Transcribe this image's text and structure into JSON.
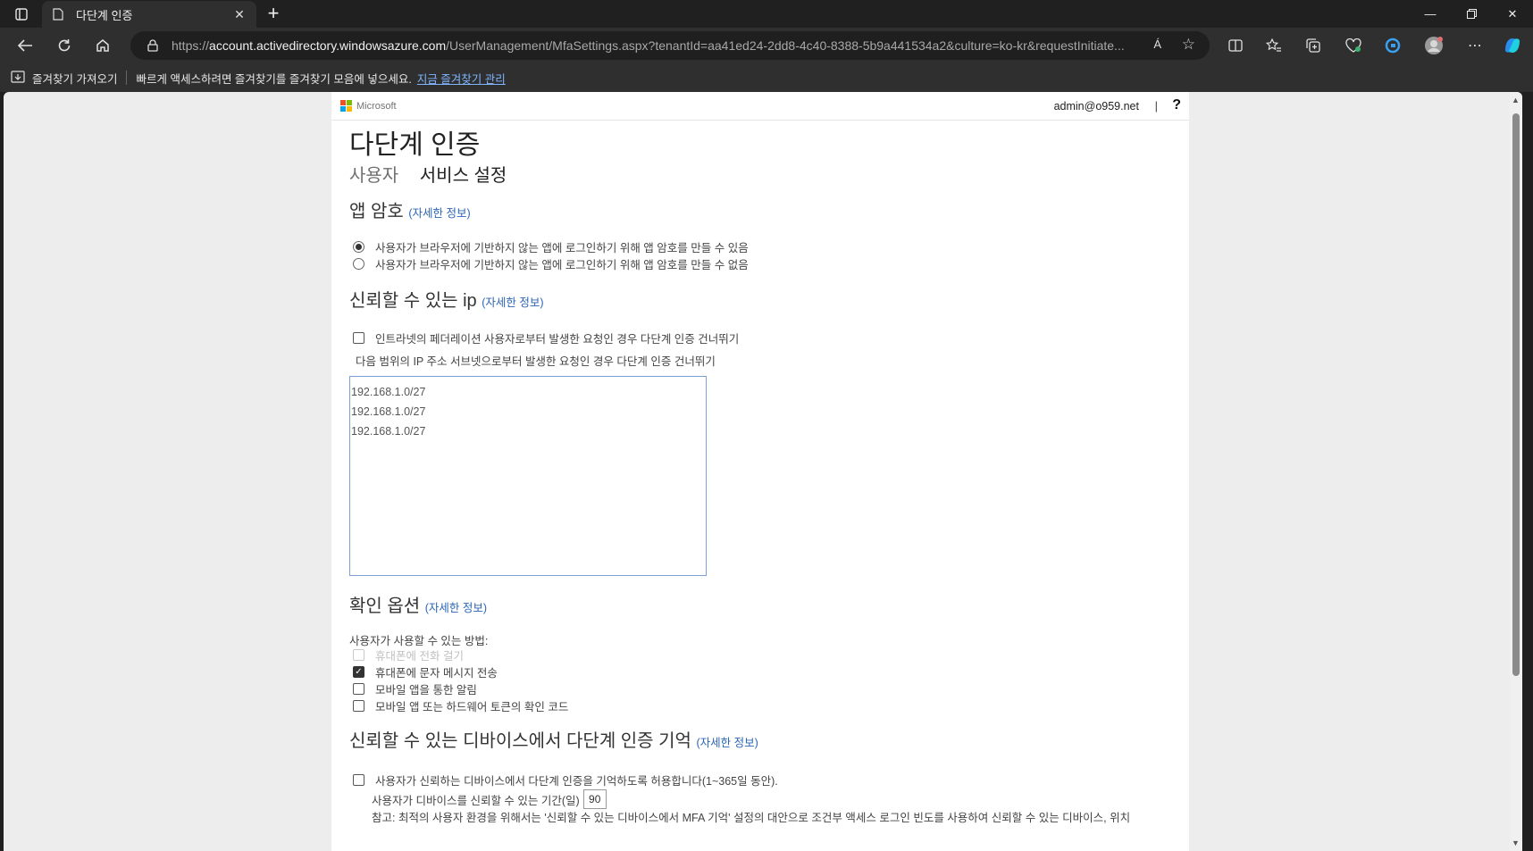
{
  "browser": {
    "tab_title": "다단계 인증",
    "url_prefix": "https://",
    "url_host": "account.activedirectory.windowsazure.com",
    "url_path": "/UserManagement/MfaSettings.aspx?tenantId=aa41ed24-2dd8-4c40-8388-5b9a441534a2&culture=ko-kr&requestInitiate...",
    "new_tab_glyph": "+",
    "read_aloud": "Á"
  },
  "favorites_bar": {
    "import_label": "즐겨찾기 가져오기",
    "hint": "빠르게 액세스하려면 즐겨찾기를 즐겨찾기 모음에 넣으세요.",
    "manage_link": "지금 즐겨찾기 관리"
  },
  "page_header": {
    "brand": "Microsoft",
    "user": "admin@o959.net",
    "separator": "|",
    "help": "?"
  },
  "page": {
    "title": "다단계 인증",
    "tabs": [
      {
        "label": "사용자"
      },
      {
        "label": "서비스 설정"
      }
    ],
    "more_info": "(자세한 정보)"
  },
  "app_passwords": {
    "title": "앱 암호",
    "options": [
      {
        "label": "사용자가 브라우저에 기반하지 않는 앱에 로그인하기 위해 앱 암호를 만들 수 있음",
        "selected": true
      },
      {
        "label": "사용자가 브라우저에 기반하지 않는 앱에 로그인하기 위해 앱 암호를 만들 수 없음",
        "selected": false
      }
    ]
  },
  "trusted_ips": {
    "title": "신뢰할 수 있는 ip",
    "federated_skip_label": "인트라넷의 페더레이션 사용자로부터 발생한 요청인 경우 다단계 인증 건너뛰기",
    "subnet_skip_label": "다음 범위의 IP 주소 서브넷으로부터 발생한 요청인 경우 다단계 인증 건너뛰기",
    "ranges": [
      "192.168.1.0/27",
      "192.168.1.0/27",
      "192.168.1.0/27"
    ]
  },
  "verification": {
    "title": "확인 옵션",
    "methods_label": "사용자가 사용할 수 있는 방법:",
    "methods": [
      {
        "label": "휴대폰에 전화 걸기",
        "checked": false,
        "disabled": true
      },
      {
        "label": "휴대폰에 문자 메시지 전송",
        "checked": true,
        "disabled": false
      },
      {
        "label": "모바일 앱을 통한 알림",
        "checked": false,
        "disabled": false
      },
      {
        "label": "모바일 앱 또는 하드웨어 토큰의 확인 코드",
        "checked": false,
        "disabled": false
      }
    ]
  },
  "remember_mfa": {
    "title": "신뢰할 수 있는 디바이스에서 다단계 인증 기억",
    "allow_label": "사용자가 신뢰하는 디바이스에서 다단계 인증을 기억하도록 허용합니다(1~365일 동안).",
    "days_label": "사용자가 디바이스를 신뢰할 수 있는 기간(일)",
    "days_value": "90",
    "note": "참고: 최적의 사용자 환경을 위해서는 '신뢰할 수 있는 디바이스에서 MFA 기억' 설정의 대안으로 조건부 액세스 로그인 빈도를 사용하여 신뢰할 수 있는 디바이스, 위치"
  },
  "colors": {
    "link": "#2b65b5",
    "browser_bg": "#202020",
    "toolbar_bg": "#2f2f2f"
  }
}
